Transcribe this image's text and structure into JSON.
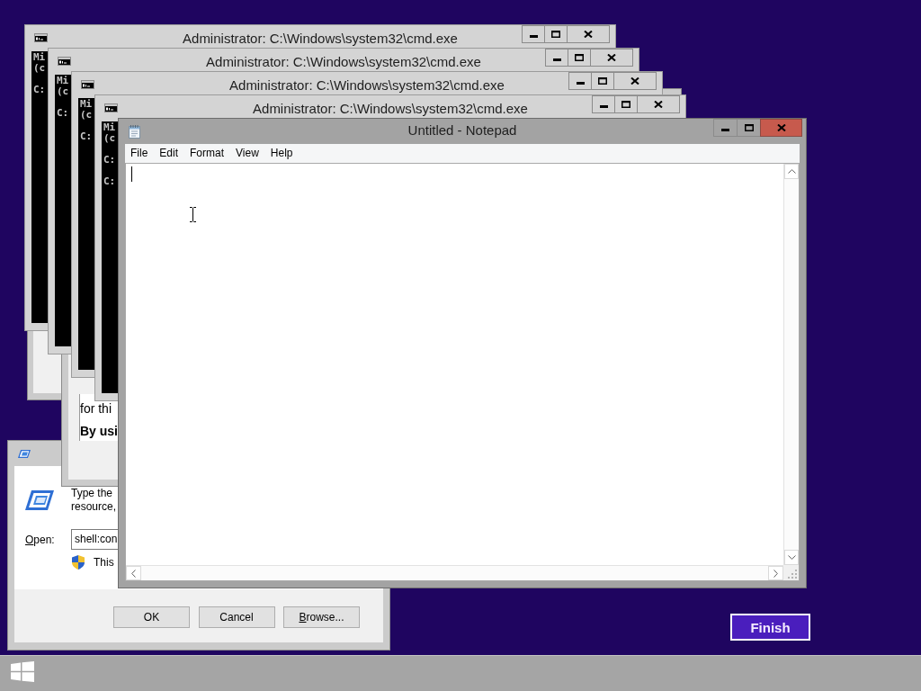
{
  "console_windows": [
    {
      "title": "Administrator: C:\\Windows\\system32\\cmd.exe",
      "active": false,
      "console_blocks": [
        [
          "Mi",
          "(c"
        ],
        [
          "C:"
        ]
      ]
    },
    {
      "title": "Administrator: C:\\Windows\\system32\\cmd.exe",
      "active": false,
      "console_blocks": [
        [
          "Mi",
          "(c"
        ],
        [
          "C:"
        ]
      ]
    },
    {
      "title": "Administrator: C:\\Windows\\system32\\cmd.exe",
      "active": false,
      "console_blocks": [
        [
          "Mi",
          "(c"
        ],
        [
          "C:"
        ]
      ]
    },
    {
      "title": "Administrator: C:\\Windows\\system32\\cmd.exe",
      "active": false,
      "console_blocks": [
        [
          "Mi",
          "(c"
        ],
        [
          "C:"
        ],
        [
          "C:"
        ]
      ]
    }
  ],
  "setup_window": {
    "paragraphs": [
      {
        "text": "for thi",
        "bold": false
      },
      {
        "text": "By usi",
        "bold": true
      }
    ]
  },
  "notepad": {
    "title": "Untitled - Notepad",
    "active": true,
    "menu": [
      "File",
      "Edit",
      "Format",
      "View",
      "Help"
    ]
  },
  "run_dialog": {
    "instructions": [
      "Type the",
      "resource,"
    ],
    "open_label": {
      "text": "Open:",
      "access_key": true
    },
    "command": "shell:con",
    "admin_note": "This",
    "buttons": [
      {
        "label": "OK",
        "access_key": false
      },
      {
        "label": "Cancel",
        "access_key": false
      },
      {
        "label": "Browse...",
        "access_key": true
      }
    ]
  },
  "finish_button": {
    "label": "Finish"
  }
}
